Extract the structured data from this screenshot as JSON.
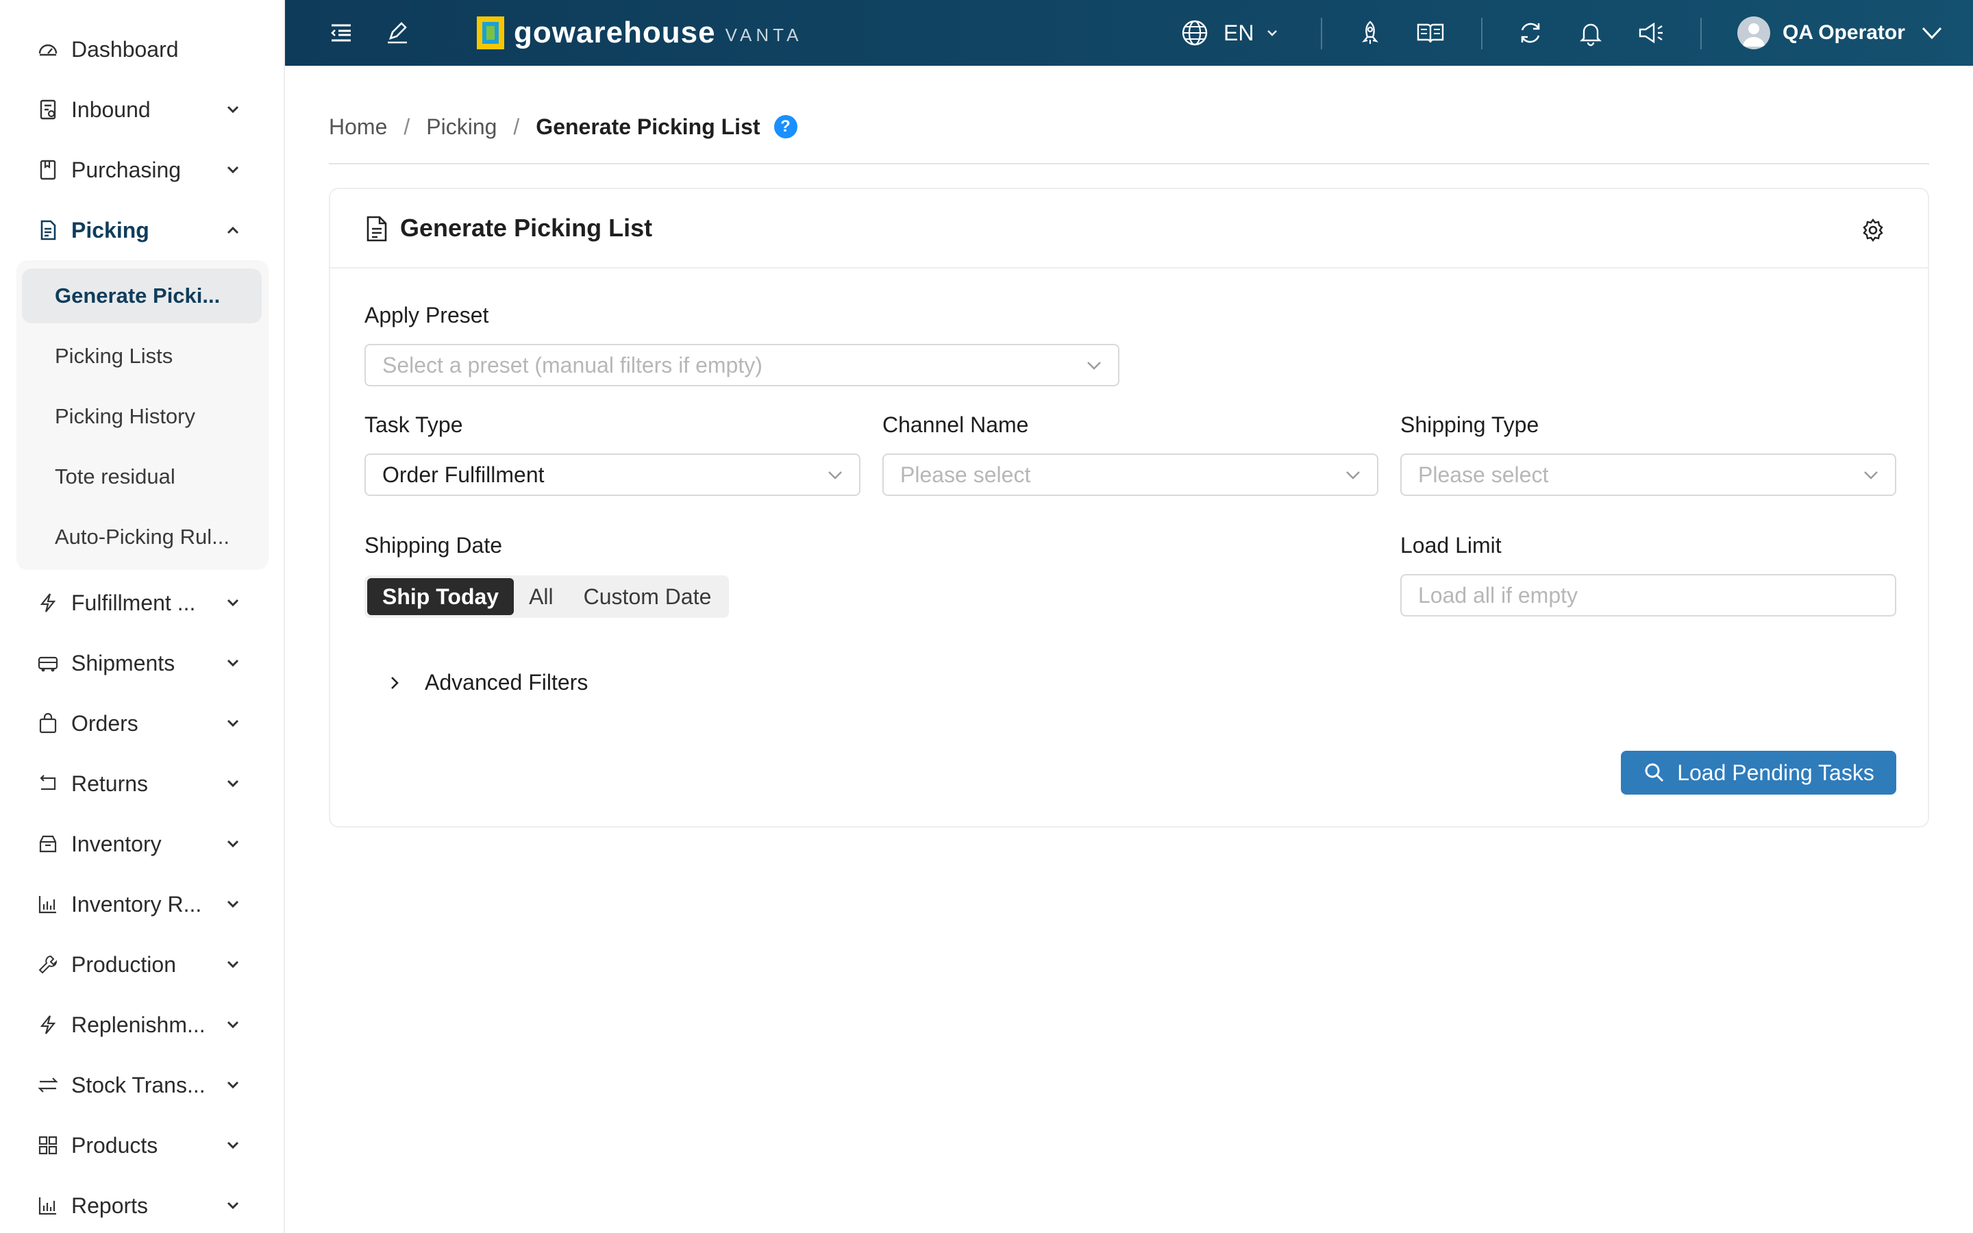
{
  "app": {
    "brand_name": "gowarehouse",
    "brand_sub": "VANTA",
    "language": "EN",
    "user_name": "QA Operator"
  },
  "sidebar": {
    "items": [
      {
        "label": "Dashboard",
        "icon": "dashboard-icon"
      },
      {
        "label": "Inbound",
        "icon": "inbound-icon"
      },
      {
        "label": "Purchasing",
        "icon": "purchasing-icon"
      },
      {
        "label": "Picking",
        "icon": "picking-icon"
      },
      {
        "label": "Fulfillment ...",
        "icon": "bolt-icon"
      },
      {
        "label": "Shipments",
        "icon": "truck-icon"
      },
      {
        "label": "Orders",
        "icon": "bag-icon"
      },
      {
        "label": "Returns",
        "icon": "return-icon"
      },
      {
        "label": "Inventory",
        "icon": "box-icon"
      },
      {
        "label": "Inventory R...",
        "icon": "bar-chart-icon"
      },
      {
        "label": "Production",
        "icon": "wrench-icon"
      },
      {
        "label": "Replenishm...",
        "icon": "bolt-icon"
      },
      {
        "label": "Stock Trans...",
        "icon": "transfer-icon"
      },
      {
        "label": "Products",
        "icon": "grid-icon"
      },
      {
        "label": "Reports",
        "icon": "bar-chart-icon"
      }
    ],
    "picking_submenu": [
      {
        "label": "Generate Picki..."
      },
      {
        "label": "Picking Lists"
      },
      {
        "label": "Picking History"
      },
      {
        "label": "Tote residual"
      },
      {
        "label": "Auto-Picking Rul..."
      }
    ]
  },
  "breadcrumb": {
    "home": "Home",
    "section": "Picking",
    "current": "Generate Picking List",
    "help": "?"
  },
  "card": {
    "title": "Generate Picking List",
    "apply_preset": {
      "label": "Apply Preset",
      "placeholder": "Select a preset (manual filters if empty)"
    },
    "task_type": {
      "label": "Task Type",
      "value": "Order Fulfillment"
    },
    "channel_name": {
      "label": "Channel Name",
      "placeholder": "Please select"
    },
    "shipping_type": {
      "label": "Shipping Type",
      "placeholder": "Please select"
    },
    "shipping_date": {
      "label": "Shipping Date",
      "options": [
        "Ship Today",
        "All",
        "Custom Date"
      ],
      "selected": "Ship Today"
    },
    "load_limit": {
      "label": "Load Limit",
      "placeholder": "Load all if empty"
    },
    "advanced_filters": "Advanced Filters",
    "load_button": "Load Pending Tasks"
  },
  "colors": {
    "header_bg": "#0e3b59",
    "accent": "#0f3d5c",
    "primary_button": "#2f7cbb",
    "help_badge": "#1890ff"
  }
}
